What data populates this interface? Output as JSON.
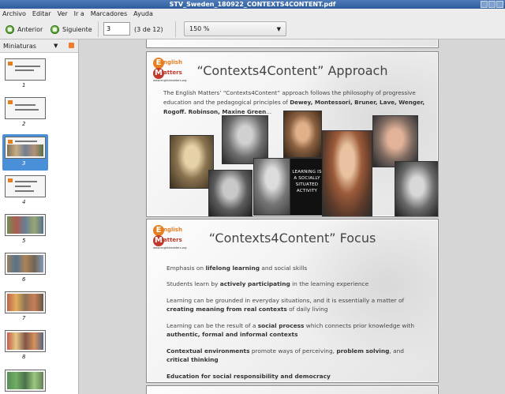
{
  "window": {
    "title": "STV_Sweden_180922_CONTEXTS4CONTENT.pdf"
  },
  "menu": [
    "Archivo",
    "Editar",
    "Ver",
    "Ir a",
    "Marcadores",
    "Ayuda"
  ],
  "toolbar": {
    "prev_label": "Anterior",
    "next_label": "Siguiente",
    "page_value": "3",
    "page_of": "(3 de 12)",
    "zoom_value": "150 %"
  },
  "sidebar": {
    "header_label": "Miniaturas",
    "thumbs": [
      {
        "num": "1"
      },
      {
        "num": "2"
      },
      {
        "num": "3"
      },
      {
        "num": "4"
      },
      {
        "num": "5"
      },
      {
        "num": "6"
      },
      {
        "num": "7"
      },
      {
        "num": "8"
      }
    ],
    "selected": 3
  },
  "slide1": {
    "logo_word1": "nglish",
    "logo_word2": "atters",
    "logo_url": "www.englishmatters.org",
    "title": "“Contexts4Content” Approach",
    "intro_plain": "The English Matters’ “Contexts4Content” approach follows the philosophy of progressive education and the pedagogical principles of",
    "intro_bold": "Dewey, Montessori, Bruner, Lave, Wenger, Rogoff. Robinson, Maxine Green",
    "intro_tail": "...",
    "poster_text": "LEARNING IS A SOCIALLY SITUATED ACTIVITY"
  },
  "slide2": {
    "logo_word1": "nglish",
    "logo_word2": "atters",
    "logo_url": "www.englishmatters.org",
    "title": "“Contexts4Content” Focus",
    "items": [
      {
        "pre": "Emphasis on ",
        "bold": "lifelong learning",
        "post": " and social skills"
      },
      {
        "pre": "Students learn by ",
        "bold": "actively participating",
        "post": " in the learning experience"
      },
      {
        "pre": "Learning can be grounded in everyday situations, and it is essentially a matter of ",
        "bold": "creating meaning from real contexts",
        "post": " of daily living"
      },
      {
        "pre": "Learning can be the result of a ",
        "bold": "social process",
        "post": " which connects prior knowledge with "
      },
      {
        "pre": "",
        "bold": "Contextual environments",
        "post": " promote ways of perceiving, "
      },
      {
        "pre": "",
        "bold": "Education for social responsibility and democracy",
        "post": ""
      }
    ],
    "item4_bold2": "authentic, formal and  informal contexts",
    "item5_bold2": "problem solving",
    "item5_mid": ", and ",
    "item5_bold3": "critical thinking"
  },
  "colors": {
    "titlebar": "#2f5c9c",
    "selection": "#4a90d9",
    "logo_orange": "#e67e22",
    "logo_red": "#c0392b"
  }
}
